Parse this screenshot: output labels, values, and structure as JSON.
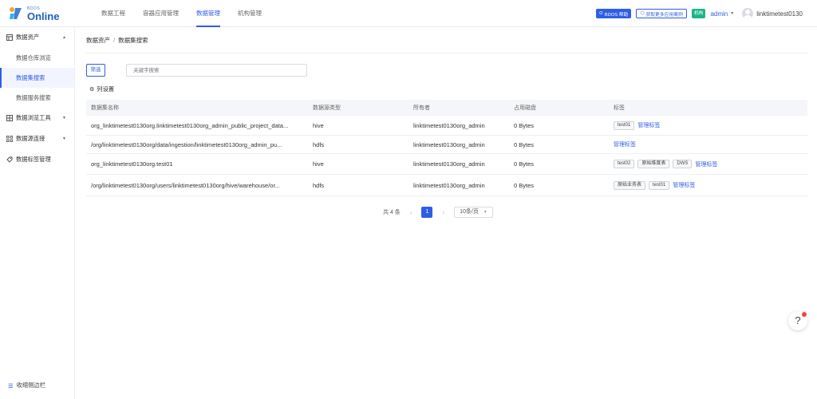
{
  "brand": {
    "small": "BDOS",
    "big": "Online"
  },
  "nav": [
    {
      "label": "数据工程",
      "active": false
    },
    {
      "label": "容器应用管理",
      "active": false
    },
    {
      "label": "数据管理",
      "active": true
    },
    {
      "label": "机构管理",
      "active": false
    }
  ],
  "topright": {
    "help": "BDOS 帮助",
    "more": "获取更多应用案例",
    "org_badge": "机构",
    "admin": "admin",
    "username": "linktimetest0130"
  },
  "sidebar": {
    "groups": [
      {
        "label": "数据资产",
        "items": [
          "数据仓库浏览",
          "数据集搜索",
          "数据服务搜索"
        ]
      },
      {
        "label": "数据浏览工具"
      },
      {
        "label": "数据源连接"
      },
      {
        "label": "数据标签管理"
      }
    ],
    "collapse": "收缩侧边栏"
  },
  "breadcrumb": [
    "数据资产",
    "数据集搜索"
  ],
  "filter": {
    "label": "筛选",
    "placeholder": "关键字搜索"
  },
  "column_settings": "列设置",
  "table": {
    "headers": [
      "数据集名称",
      "数据源类型",
      "所有者",
      "占用磁盘",
      "标签"
    ],
    "rows": [
      {
        "name": "org_linktimetest0130org.linktimetest0130org_admin_public_project_data...",
        "type": "hive",
        "owner": "linktimetest0130org_admin",
        "size": "0 Bytes",
        "tags": [
          "test01"
        ],
        "manage": "管理标签"
      },
      {
        "name": "/org/linktimetest0130org/data/ingestion/linktimetest0130org_admin_pu...",
        "type": "hdfs",
        "owner": "linktimetest0130org_admin",
        "size": "0 Bytes",
        "tags": [],
        "manage": "管理标签"
      },
      {
        "name": "org_linktimetest0130org.test01",
        "type": "hive",
        "owner": "linktimetest0130org_admin",
        "size": "0 Bytes",
        "tags": [
          "test02",
          "原始维度表",
          "DWS"
        ],
        "manage": "管理标签"
      },
      {
        "name": "/org/linktimetest0130org/users/linktimetest0130org/hive/warehouse/or...",
        "type": "hdfs",
        "owner": "linktimetest0130org_admin",
        "size": "0 Bytes",
        "tags": [
          "原始业务表",
          "test01"
        ],
        "manage": "管理标签"
      }
    ]
  },
  "pager": {
    "total": "共 4 条",
    "current": "1",
    "size": "10条/页"
  },
  "help_float": "?"
}
